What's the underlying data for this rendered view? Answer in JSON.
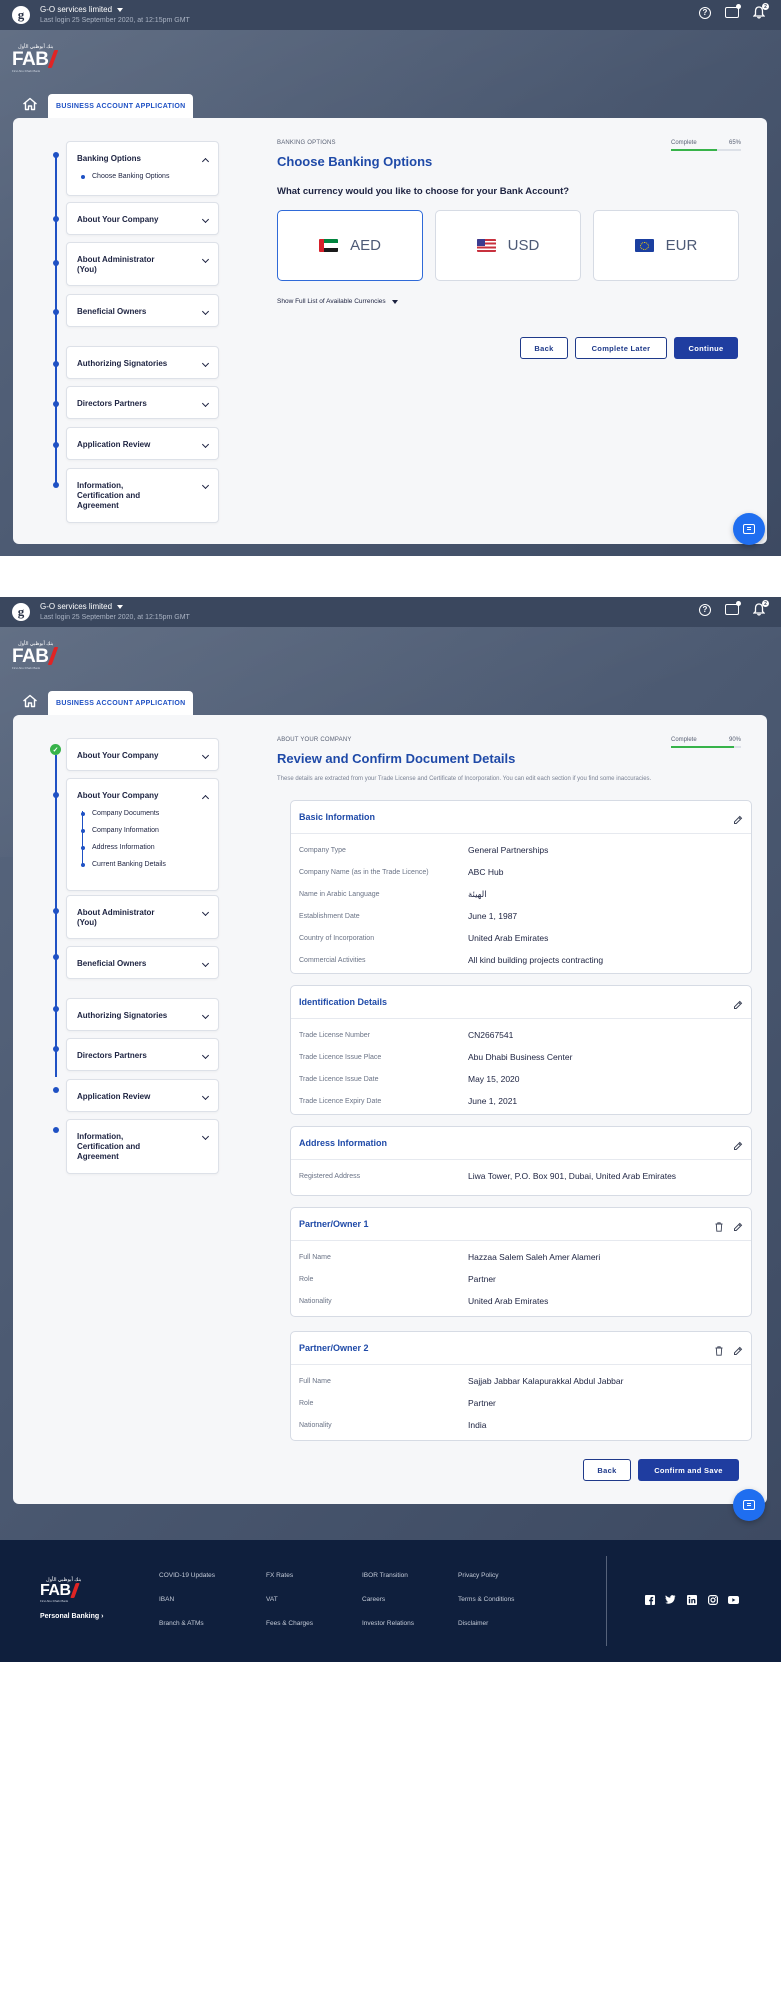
{
  "topbar": {
    "logo_letter": "g",
    "account_name": "G-O services limited",
    "last_login": "Last login 25 September 2020, at 12:15pm  GMT",
    "help_icon": "?",
    "notification_count": "2"
  },
  "brand": {
    "arabic": "بنك أبوظبي الأول",
    "wordmark": "FAB",
    "tagline": "First Abu Dhabi Bank"
  },
  "tab_label": "BUSINESS ACCOUNT APPLICATION",
  "screen1": {
    "steps": [
      {
        "label": "Banking Options",
        "sub": [
          "Choose Banking Options"
        ]
      },
      {
        "label": "About Your Company"
      },
      {
        "label": "About Administrator (You)"
      },
      {
        "label": "Beneficial Owners"
      },
      {
        "label": "Authorizing Signatories"
      },
      {
        "label": "Directors Partners"
      },
      {
        "label": "Application Review"
      },
      {
        "label": "Information, Certification and Agreement"
      }
    ],
    "section_label": "BANKING OPTIONS",
    "title": "Choose Banking Options",
    "complete_label": "Complete",
    "complete_pct": "65%",
    "complete_fraction": 0.65,
    "question": "What currency would you like to choose for your Bank Account?",
    "currencies": [
      {
        "code": "AED",
        "flag": "uae-flag-icon",
        "selected": true
      },
      {
        "code": "USD",
        "flag": "us-flag-icon",
        "selected": false
      },
      {
        "code": "EUR",
        "flag": "eu-flag-icon",
        "selected": false
      }
    ],
    "show_all": "Show Full List of Available Currencies",
    "buttons": {
      "back": "Back",
      "later": "Complete Later",
      "continue": "Continue"
    }
  },
  "screen2": {
    "steps": [
      {
        "label": "About Your Company"
      },
      {
        "label": "About Your Company",
        "sub": [
          "Company Documents",
          "Company Information",
          "Address Information",
          "Current Banking Details"
        ]
      },
      {
        "label": "About Administrator (You)"
      },
      {
        "label": "Beneficial Owners"
      },
      {
        "label": "Authorizing Signatories"
      },
      {
        "label": "Directors Partners"
      },
      {
        "label": "Application Review"
      },
      {
        "label": "Information, Certification and Agreement"
      }
    ],
    "section_label": "ABOUT YOUR COMPANY",
    "title": "Review and Confirm Document Details",
    "description": "These details are extracted from your Trade License and Certificate of Incorporation. You can edit each section if you find some inaccuracies.",
    "complete_label": "Complete",
    "complete_pct": "90%",
    "complete_fraction": 0.9,
    "panels": {
      "basic": {
        "title": "Basic Information",
        "rows": [
          {
            "k": "Company Type",
            "v": "General Partnerships"
          },
          {
            "k": "Company Name (as in the Trade Licence)",
            "v": "ABC Hub"
          },
          {
            "k": "Name in Arabic Language",
            "v": "الهيئة"
          },
          {
            "k": "Establishment Date",
            "v": "June 1, 1987"
          },
          {
            "k": "Country of Incorporation",
            "v": "United Arab Emirates"
          },
          {
            "k": "Commercial Activities",
            "v": "All kind building projects contracting"
          }
        ]
      },
      "ident": {
        "title": "Identification Details",
        "rows": [
          {
            "k": "Trade License Number",
            "v": "CN2667541"
          },
          {
            "k": "Trade Licence Issue Place",
            "v": "Abu Dhabi Business Center"
          },
          {
            "k": "Trade Licence Issue Date",
            "v": "May 15, 2020"
          },
          {
            "k": "Trade Licence Expiry Date",
            "v": "June 1, 2021"
          }
        ]
      },
      "address": {
        "title": "Address Information",
        "rows": [
          {
            "k": "Registered Address",
            "v": "Liwa Tower, P.O. Box 901, Dubai, United Arab Emirates"
          }
        ]
      },
      "partner1": {
        "title": "Partner/Owner 1",
        "rows": [
          {
            "k": "Full Name",
            "v": "Hazzaa Salem Saleh Amer Alameri"
          },
          {
            "k": "Role",
            "v": "Partner"
          },
          {
            "k": "Nationality",
            "v": "United Arab Emirates"
          }
        ]
      },
      "partner2": {
        "title": "Partner/Owner 2",
        "rows": [
          {
            "k": "Full Name",
            "v": "Sajjab Jabbar Kalapurakkal Abdul Jabbar"
          },
          {
            "k": "Role",
            "v": "Partner"
          },
          {
            "k": "Nationality",
            "v": "India"
          }
        ]
      }
    },
    "buttons": {
      "back": "Back",
      "confirm": "Confirm and Save"
    }
  },
  "footer": {
    "personal_banking": "Personal Banking ›",
    "col1": [
      "COVID-19 Updates",
      "IBAN",
      "Branch & ATMs"
    ],
    "col2": [
      "FX Rates",
      "VAT",
      "Fees & Charges"
    ],
    "col3": [
      "IBOR Transition",
      "Careers",
      "Investor Relations"
    ],
    "col4": [
      "Privacy Policy",
      "Terms & Conditions",
      "Disclaimer"
    ],
    "social": [
      "facebook-icon",
      "twitter-icon",
      "linkedin-icon",
      "instagram-icon",
      "youtube-icon"
    ]
  },
  "colors": {
    "brand_blue": "#1f3da0",
    "accent_red": "#e02424",
    "progress_green": "#37b34a",
    "footer_navy": "#0f1f3d"
  }
}
